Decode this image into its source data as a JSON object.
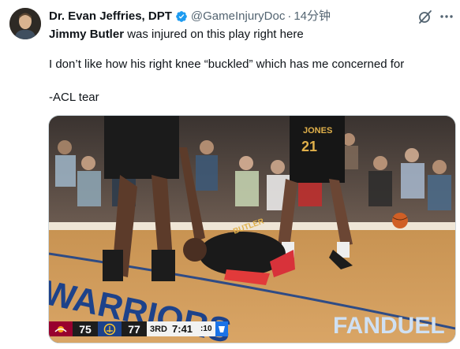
{
  "tweet": {
    "author_name": "Dr. Evan Jeffries, DPT",
    "handle": "@GameInjuryDoc",
    "separator": "·",
    "time": "14分钟",
    "line1_mention": "Jimmy Butler",
    "line1_rest": " was injured on this play right here",
    "line2": "I don’t like how his right knee “buckled” which has me concerned for",
    "line3": "-ACL tear"
  },
  "icons": {
    "verified": "verified-badge-icon",
    "grok": "grok-icon",
    "more": "more-options-icon"
  },
  "media": {
    "court_text_left": "WARRIORS",
    "court_text_right": "FANDUEL",
    "jersey_back": "21",
    "jersey_top": "JONES",
    "jersey_player_down": "BUTLER",
    "scorebug": {
      "away_score": "75",
      "home_score": "77",
      "quarter": "3RD",
      "clock": "7:41",
      "shot_clock": ":10"
    }
  },
  "colors": {
    "verified": "#1d9bf0",
    "secondary_text": "#536471",
    "heat": "#98002e",
    "warriors": "#1d428a"
  }
}
